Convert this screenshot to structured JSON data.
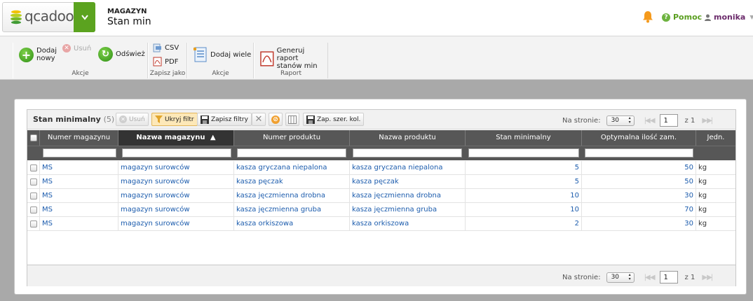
{
  "app": {
    "logo_text": "qcadoo",
    "module": "MAGAZYN",
    "page_title": "Stan min"
  },
  "header": {
    "help_label": "Pomoc",
    "user_name": "monika"
  },
  "ribbon": {
    "groups": [
      {
        "label": "Akcje",
        "buttons": [
          {
            "label_line1": "Dodaj",
            "label_line2": "nowy"
          },
          {
            "label": "Usuń"
          },
          {
            "label": "Odśwież"
          }
        ]
      },
      {
        "label": "Zapisz jako",
        "buttons": [
          {
            "label": "CSV"
          },
          {
            "label": "PDF"
          }
        ]
      },
      {
        "label": "Akcje",
        "buttons": [
          {
            "label": "Dodaj wiele"
          }
        ]
      },
      {
        "label": "Raport",
        "buttons": [
          {
            "label_line1": "Generuj raport",
            "label_line2": "stanów min"
          }
        ]
      }
    ]
  },
  "grid": {
    "title": "Stan minimalny",
    "count": "(5)",
    "toolbar": {
      "delete_label": "Usuń",
      "hide_filter_label": "Ukryj filtr",
      "save_filter_label": "Zapisz filtry",
      "save_widths_label": "Zap. szer. kol."
    },
    "pager": {
      "per_page_label": "Na stronie:",
      "per_page_value": "30",
      "current_page": "1",
      "of_label": "z 1"
    },
    "columns": [
      {
        "label": "Numer magazynu"
      },
      {
        "label": "Nazwa magazynu",
        "sort": "▲"
      },
      {
        "label": "Numer produktu"
      },
      {
        "label": "Nazwa produktu"
      },
      {
        "label": "Stan minimalny"
      },
      {
        "label": "Optymalna ilość zam."
      },
      {
        "label": "Jedn."
      }
    ],
    "rows": [
      [
        "MS",
        "magazyn surowców",
        "kasza gryczana niepalona",
        "kasza gryczana niepalona",
        "5",
        "50",
        "kg"
      ],
      [
        "MS",
        "magazyn surowców",
        "kasza pęczak",
        "kasza pęczak",
        "5",
        "50",
        "kg"
      ],
      [
        "MS",
        "magazyn surowców",
        "kasza jęczmienna drobna",
        "kasza jęczmienna drobna",
        "10",
        "30",
        "kg"
      ],
      [
        "MS",
        "magazyn surowców",
        "kasza jęczmienna gruba",
        "kasza jęczmienna gruba",
        "10",
        "70",
        "kg"
      ],
      [
        "MS",
        "magazyn surowców",
        "kasza orkiszowa",
        "kasza orkiszowa",
        "2",
        "30",
        "kg"
      ]
    ]
  },
  "colors": {
    "brand_green": "#5ba31f",
    "link_blue": "#1c5cad",
    "header_dark": "#575757"
  }
}
